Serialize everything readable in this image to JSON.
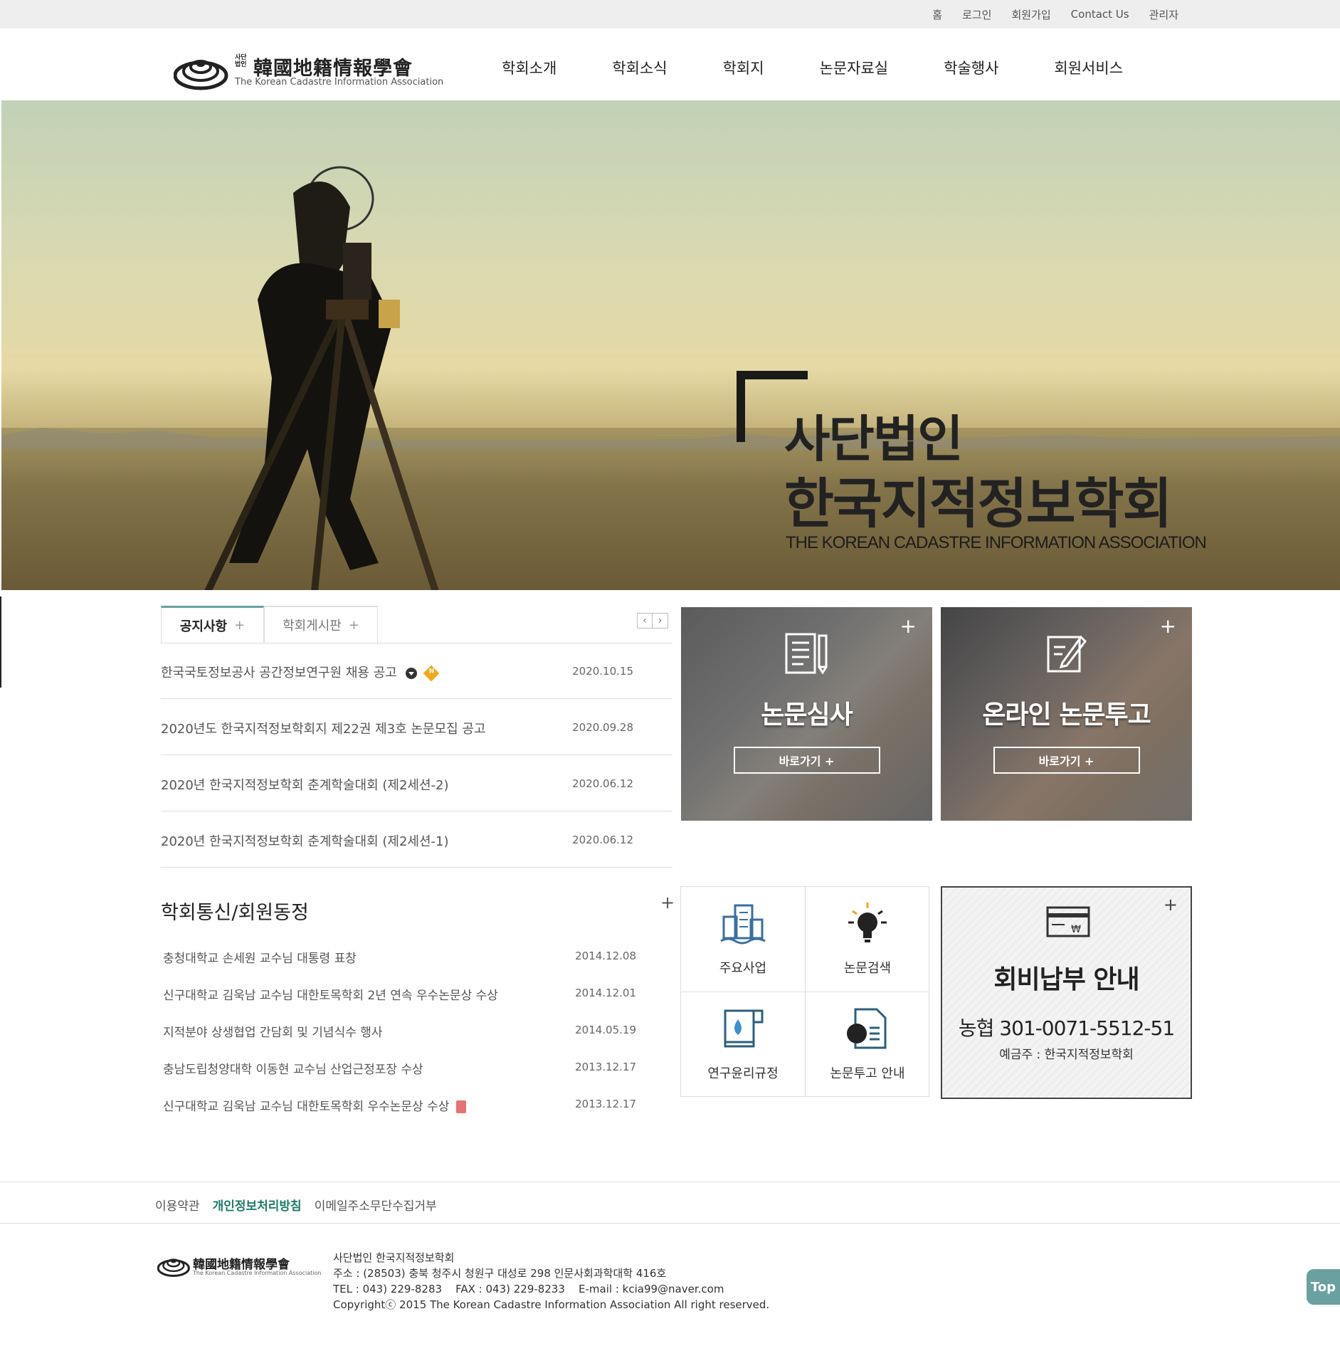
{
  "util_links": [
    "홈",
    "로그인",
    "회원가입",
    "Contact Us",
    "관리자"
  ],
  "logo": {
    "tag_line1": "사단",
    "tag_line2": "법인",
    "hanja": "韓國地籍情報學會",
    "english": "The Korean Cadastre Information Association"
  },
  "gnb": [
    "학회소개",
    "학회소식",
    "학회지",
    "논문자료실",
    "학술행사",
    "회원서비스"
  ],
  "hero": {
    "title_line1": "사단법인",
    "title_line2": "한국지적정보학회",
    "subtitle": "THE KOREAN CADASTRE INFORMATION ASSOCIATION"
  },
  "notice": {
    "tab_active": "공지사항",
    "tab_inactive": "학회게시판",
    "tab_plus": "+",
    "prev_arrow": "‹",
    "next_arrow": "›",
    "new_badge": "N",
    "items": [
      {
        "title": "한국국토정보공사 공간정보연구원 채용 공고",
        "date": "2020.10.15"
      },
      {
        "title": "2020년도 한국지적정보학회지 제22권 제3호 논문모집 공고",
        "date": "2020.09.28"
      },
      {
        "title": "2020년 한국지적정보학회 춘계학술대회 (제2세션-2)",
        "date": "2020.06.12"
      },
      {
        "title": "2020년 한국지적정보학회 춘계학술대회 (제2세션-1)",
        "date": "2020.06.12"
      }
    ]
  },
  "news": {
    "title": "학회통신/회원동정",
    "plus": "+",
    "items": [
      {
        "title": "충청대학교 손세원 교수님 대통령 표창",
        "date": "2014.12.08"
      },
      {
        "title": "신구대학교 김욱남 교수님 대한토목학회 2년 연속 우수논문상 수상",
        "date": "2014.12.01"
      },
      {
        "title": "지적분야 상생협업 간담회 및 기념식수 행사",
        "date": "2014.05.19"
      },
      {
        "title": "충남도립청양대학 이동현 교수님 산업근정포장 수상",
        "date": "2013.12.17"
      },
      {
        "title": "신구대학교 김욱남 교수님 대한토목학회 우수논문상 수상",
        "date": "2013.12.17"
      }
    ]
  },
  "promo": {
    "box1_title": "논문심사",
    "box2_title": "온라인 논문투고",
    "button_label": "바로가기  +",
    "plus": "+"
  },
  "quick": {
    "items": [
      "주요사업",
      "논문검색",
      "연구윤리규정",
      "논문투고 안내"
    ]
  },
  "fee": {
    "plus": "+",
    "title": "회비납부 안내",
    "account": "농협 301-0071-5512-51",
    "holder": "예금주 : 한국지적정보학회"
  },
  "footer": {
    "links": [
      "이용약관",
      "개인정보처리방침",
      "이메일주소무단수집거부"
    ],
    "org": "사단법인 한국지적정보학회",
    "address": "주소 : (28503) 충북 청주시 청원구 대성로 298 인문사회과학대학 416호",
    "contact": "TEL : 043) 229-8283    FAX : 043) 229-8233    E-mail : kcia99@naver.com",
    "copyright": "Copyrightⓒ 2015 The Korean Cadastre Information Association All right reserved."
  },
  "top_button": "Top",
  "colors": {
    "accent": "#6aa0a0",
    "policy_link": "#1e7a6a",
    "util_bar_bg": "#eeeeee"
  }
}
